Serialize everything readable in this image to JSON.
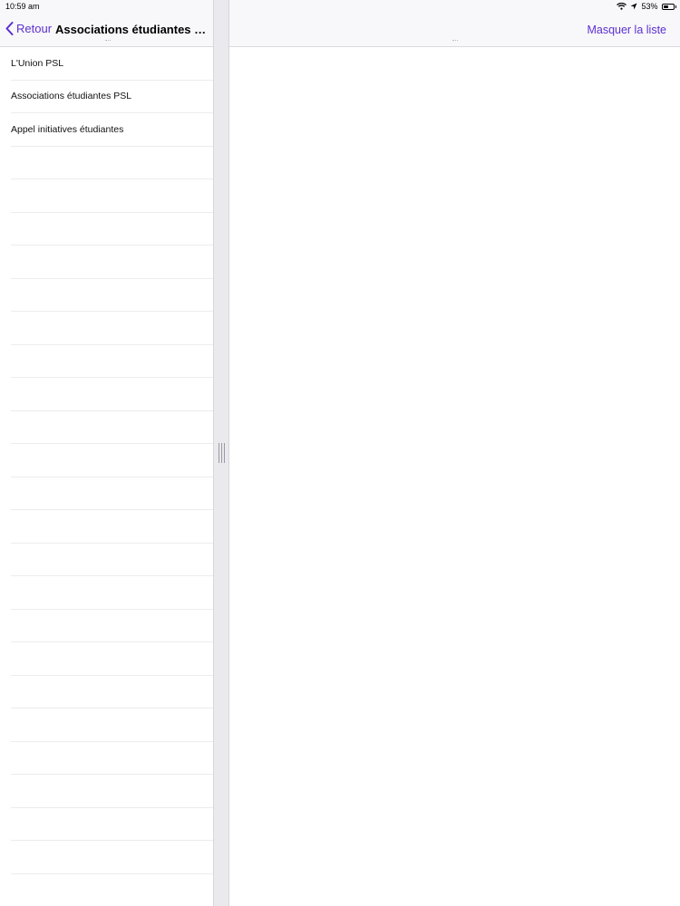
{
  "status_bar": {
    "time": "10:59 am",
    "battery": "53%",
    "battery_level": 0.53
  },
  "master": {
    "back_label": "Retour",
    "title": "Associations étudiantes m...",
    "items": [
      {
        "label": "L'Union PSL"
      },
      {
        "label": "Associations étudiantes PSL"
      },
      {
        "label": "Appel initiatives étudiantes"
      }
    ],
    "empty_rows": 22
  },
  "detail": {
    "hide_list_label": "Masquer la liste"
  },
  "colors": {
    "accent": "#5b2fd0",
    "nav_background": "#f8f8fa",
    "divider": "#e9e9ee"
  },
  "icons": {
    "back": "chevron-left-icon",
    "wifi": "wifi-icon",
    "location": "location-arrow-icon",
    "battery": "battery-icon"
  }
}
